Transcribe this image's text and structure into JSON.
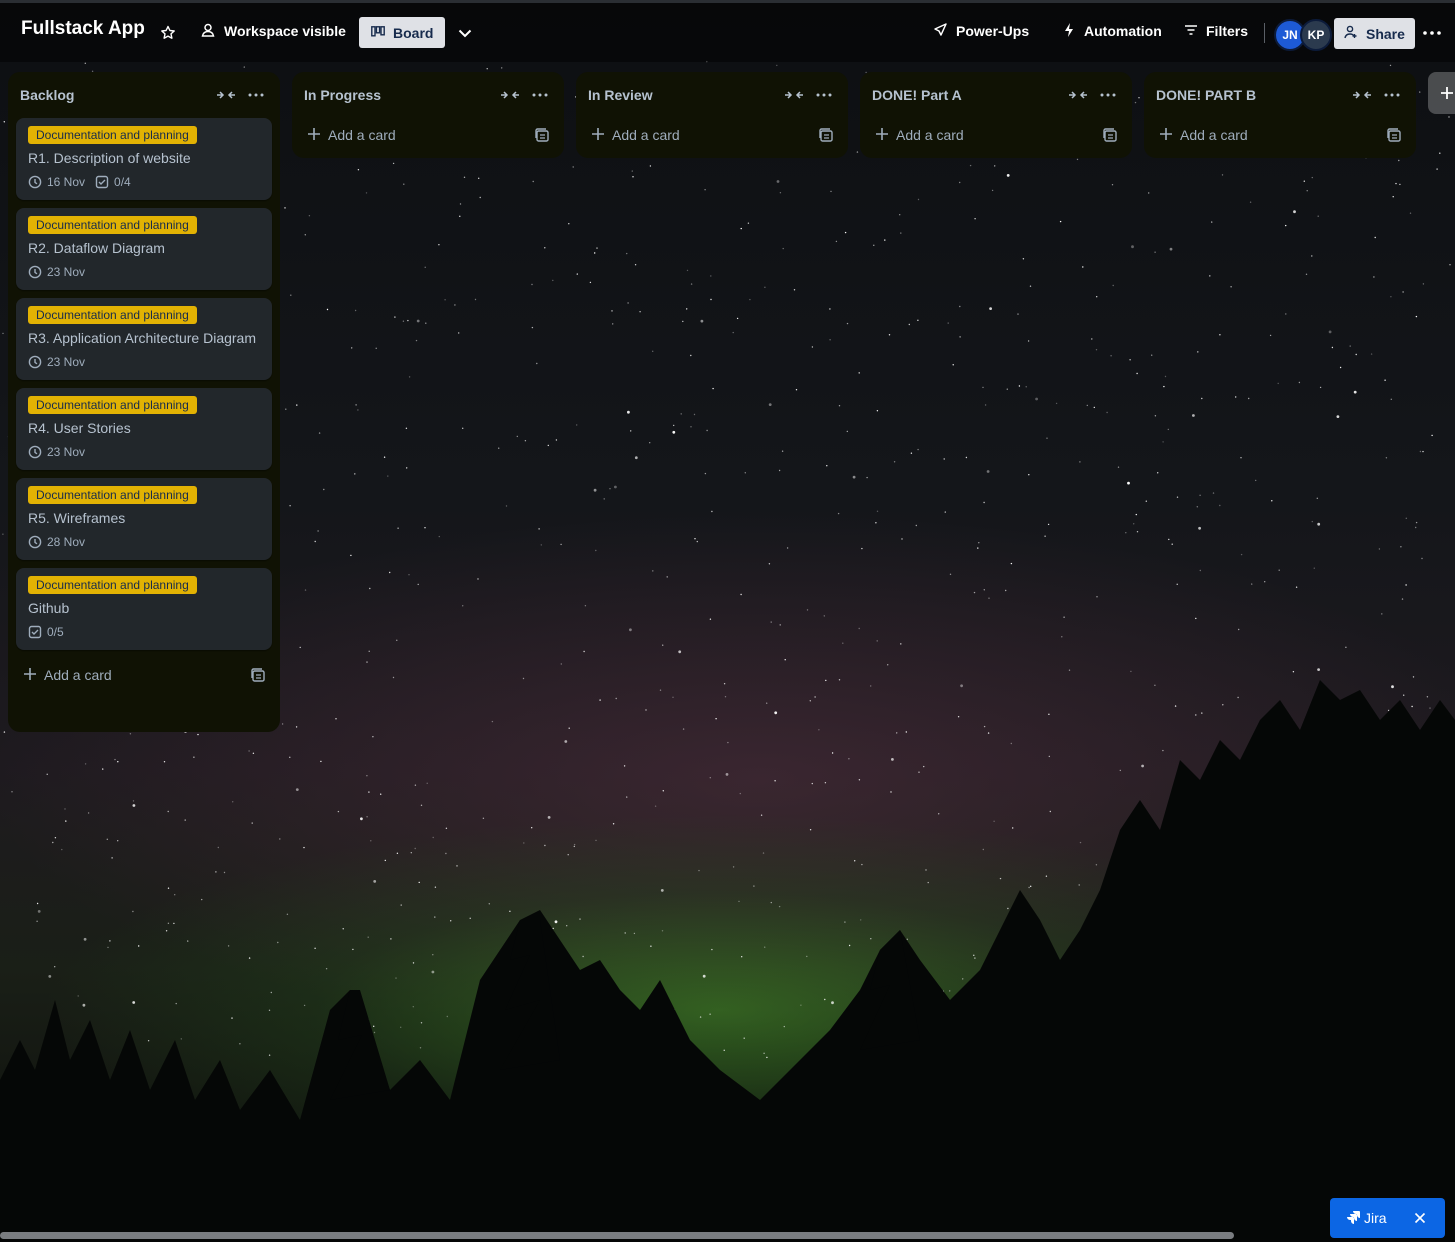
{
  "header": {
    "board_title": "Fullstack App",
    "visibility_label": "Workspace visible",
    "view_label": "Board",
    "powerups_label": "Power-Ups",
    "automation_label": "Automation",
    "filters_label": "Filters",
    "avatars": [
      {
        "initials": "JN",
        "color": "#1d5ad6"
      },
      {
        "initials": "KP",
        "color": "#2b3a4e"
      }
    ],
    "share_label": "Share"
  },
  "lists": [
    {
      "title": "Backlog",
      "add_label": "Add a card",
      "cards": [
        {
          "label": "Documentation and planning",
          "title": "R1. Description of website",
          "date": "16 Nov",
          "checklist": "0/4"
        },
        {
          "label": "Documentation and planning",
          "title": "R2. Dataflow Diagram",
          "date": "23 Nov"
        },
        {
          "label": "Documentation and planning",
          "title": "R3. Application Architecture Diagram",
          "date": "23 Nov"
        },
        {
          "label": "Documentation and planning",
          "title": "R4. User Stories",
          "date": "23 Nov"
        },
        {
          "label": "Documentation and planning",
          "title": "R5. Wireframes",
          "date": "28 Nov"
        },
        {
          "label": "Documentation and planning",
          "title": "Github",
          "checklist": "0/5"
        }
      ]
    },
    {
      "title": "In Progress",
      "add_label": "Add a card",
      "cards": []
    },
    {
      "title": "In Review",
      "add_label": "Add a card",
      "cards": []
    },
    {
      "title": "DONE! Part A",
      "add_label": "Add a card",
      "cards": []
    },
    {
      "title": "DONE! PART B",
      "add_label": "Add a card",
      "cards": []
    }
  ],
  "jira": {
    "label": "Jira"
  },
  "colors": {
    "label_yellow": "#e2b203",
    "list_bg": "#101204",
    "card_bg": "#22272b",
    "jira_blue": "#0c66e4"
  }
}
